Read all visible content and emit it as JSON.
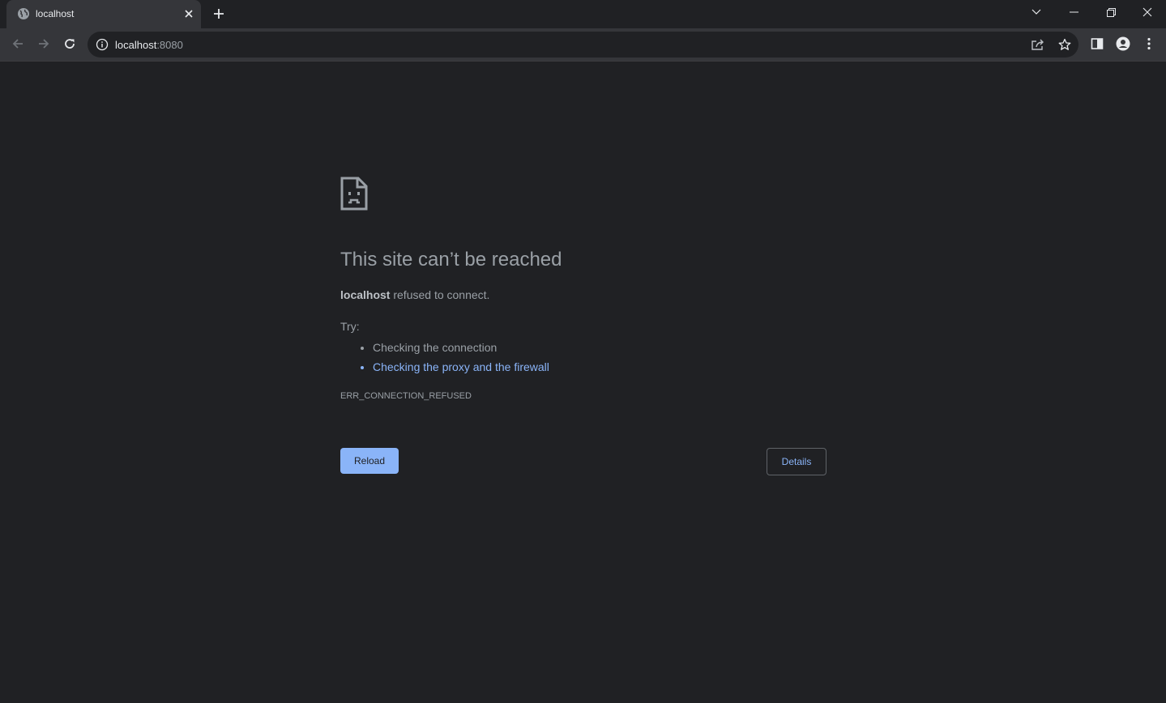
{
  "tab": {
    "title": "localhost",
    "favicon": "globe-icon",
    "close": "close-icon",
    "new_tab": "plus-icon"
  },
  "window_controls": [
    "chevron-down-icon",
    "minimize-icon",
    "restore-icon",
    "close-icon"
  ],
  "toolbar": {
    "back": "arrow-left-icon",
    "forward": "arrow-right-icon",
    "reload": "reload-icon",
    "info": "info-icon",
    "url_host": "localhost",
    "url_port": ":8080",
    "share": "share-icon",
    "bookmark": "star-icon",
    "side_panel": "side-panel-icon",
    "profile": "profile-icon",
    "menu": "kebab-menu-icon"
  },
  "error": {
    "icon": "sad-page-icon",
    "title": "This site can’t be reached",
    "host": "localhost",
    "summary_rest": " refused to connect.",
    "try_label": "Try:",
    "suggestions": [
      "Checking the connection",
      "Checking the proxy and the firewall"
    ],
    "code": "ERR_CONNECTION_REFUSED",
    "reload_label": "Reload",
    "details_label": "Details"
  },
  "colors": {
    "page_bg": "#202124",
    "toolbar_bg": "#35363a",
    "text_secondary": "#9aa0a6",
    "link": "#8ab4f8"
  }
}
